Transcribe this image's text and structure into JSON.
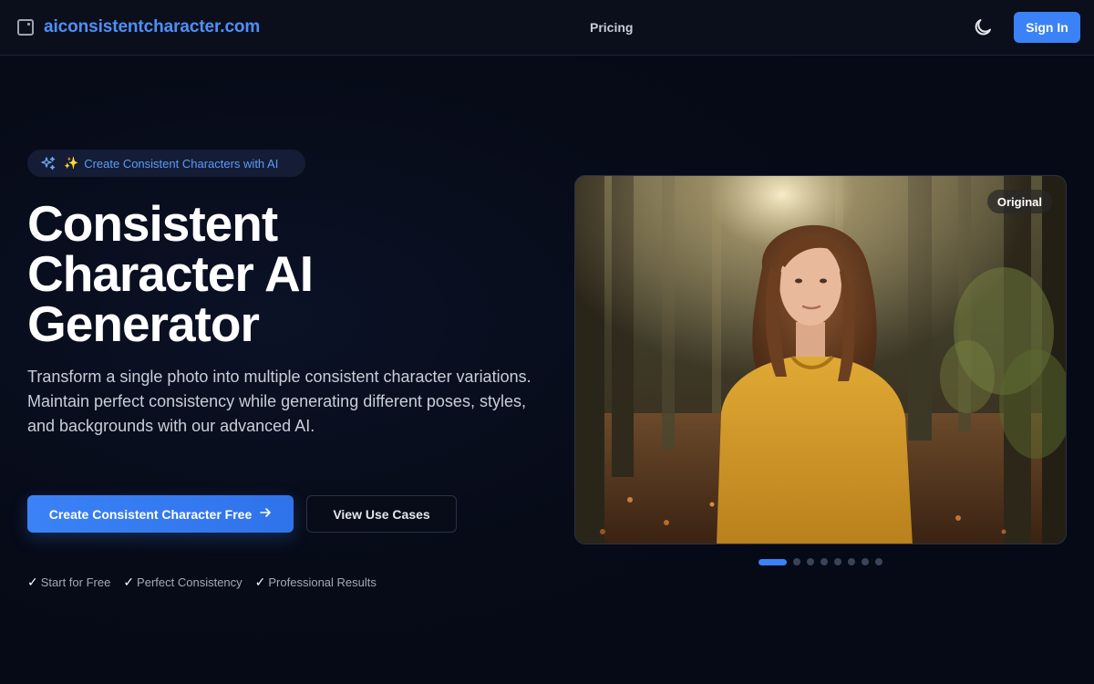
{
  "header": {
    "logo_text": "aiconsistentcharacter.com",
    "nav_pricing": "Pricing",
    "sign_in": "Sign In"
  },
  "hero": {
    "badge_emoji": "✨",
    "badge_text": "Create Consistent Characters with AI",
    "title_line1": "Consistent",
    "title_line2": "Character AI",
    "title_line3": "Generator",
    "subtitle": "Transform a single photo into multiple consistent character variations. Maintain perfect consistency while generating different poses, styles, and backgrounds with our advanced AI.",
    "primary_button": "Create Consistent Character Free",
    "secondary_button": "View Use Cases",
    "features": [
      {
        "check": "✓",
        "label": "Start for Free"
      },
      {
        "check": "✓",
        "label": "Perfect Consistency"
      },
      {
        "check": "✓",
        "label": "Professional Results"
      }
    ],
    "image_label": "Original",
    "carousel": {
      "total": 8,
      "active": 1
    }
  },
  "colors": {
    "accent": "#3b82f6",
    "logo": "#4f8ff7",
    "background": "#060a17"
  },
  "icons": {
    "logo": "square-logo-icon",
    "theme": "moon-icon",
    "badge": "sparkles-icon",
    "button_arrow": "arrow-right-icon"
  }
}
